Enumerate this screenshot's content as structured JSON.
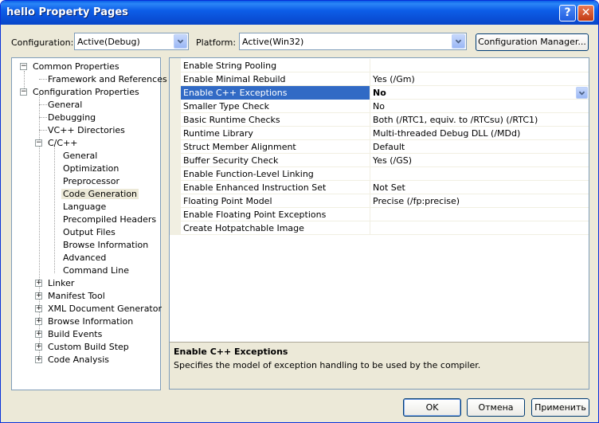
{
  "window": {
    "title": "hello Property Pages"
  },
  "toolbar": {
    "configuration_label": "Configuration:",
    "configuration_value": "Active(Debug)",
    "platform_label": "Platform:",
    "platform_value": "Active(Win32)",
    "config_manager_label": "Configuration Manager..."
  },
  "tree": {
    "common_properties": "Common Properties",
    "framework_refs": "Framework and References",
    "configuration_properties": "Configuration Properties",
    "general": "General",
    "debugging": "Debugging",
    "vc_dirs": "VC++ Directories",
    "cpp": "C/C++",
    "cpp_children": [
      "General",
      "Optimization",
      "Preprocessor",
      "Code Generation",
      "Language",
      "Precompiled Headers",
      "Output Files",
      "Browse Information",
      "Advanced",
      "Command Line"
    ],
    "selected": "Code Generation",
    "more": [
      "Linker",
      "Manifest Tool",
      "XML Document Generator",
      "Browse Information",
      "Build Events",
      "Custom Build Step",
      "Code Analysis"
    ]
  },
  "properties": [
    {
      "name": "Enable String Pooling",
      "value": ""
    },
    {
      "name": "Enable Minimal Rebuild",
      "value": "Yes (/Gm)"
    },
    {
      "name": "Enable C++ Exceptions",
      "value": "No",
      "selected": true
    },
    {
      "name": "Smaller Type Check",
      "value": "No"
    },
    {
      "name": "Basic Runtime Checks",
      "value": "Both (/RTC1, equiv. to /RTCsu) (/RTC1)"
    },
    {
      "name": "Runtime Library",
      "value": "Multi-threaded Debug DLL (/MDd)"
    },
    {
      "name": "Struct Member Alignment",
      "value": "Default"
    },
    {
      "name": "Buffer Security Check",
      "value": "Yes (/GS)"
    },
    {
      "name": "Enable Function-Level Linking",
      "value": ""
    },
    {
      "name": "Enable Enhanced Instruction Set",
      "value": "Not Set"
    },
    {
      "name": "Floating Point Model",
      "value": "Precise (/fp:precise)"
    },
    {
      "name": "Enable Floating Point Exceptions",
      "value": ""
    },
    {
      "name": "Create Hotpatchable Image",
      "value": ""
    }
  ],
  "description": {
    "title": "Enable C++ Exceptions",
    "text": "Specifies the model of exception handling to be used by the compiler."
  },
  "buttons": {
    "ok": "OK",
    "cancel": "Отмена",
    "apply": "Применить"
  }
}
